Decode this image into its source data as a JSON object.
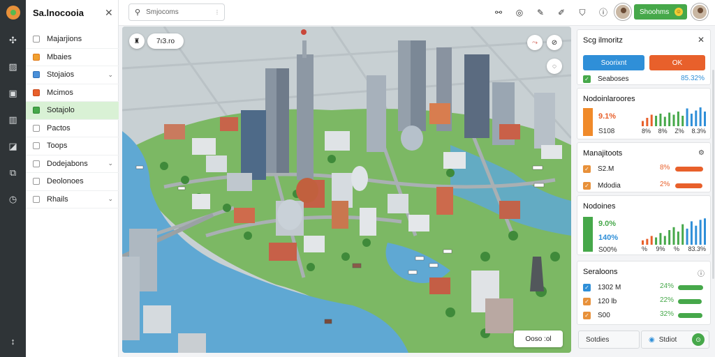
{
  "app": {
    "title": "Sa.lnocooia"
  },
  "search": {
    "placeholder": "Smjocoms",
    "value": ""
  },
  "colors": {
    "accent_green": "#46a84a",
    "accent_blue": "#2f8fd8",
    "accent_orange": "#e8602b",
    "rail": "#2f3437"
  },
  "rail_icons": [
    "compass-icon",
    "map-icon",
    "image-icon",
    "grid-icon",
    "chart-icon",
    "filter-icon",
    "clock-icon",
    "move-icon"
  ],
  "sidebar": {
    "items": [
      {
        "label": "Majarjions",
        "color": "#ffffff",
        "border": "#999999",
        "chevron": false,
        "active": false
      },
      {
        "label": "Mbaies",
        "color": "#f0a030",
        "border": "#e07a1a",
        "chevron": false,
        "active": false
      },
      {
        "label": "Stojaios",
        "color": "#4a90d9",
        "border": "#2e6fb6",
        "chevron": true,
        "active": false
      },
      {
        "label": "Mcimos",
        "color": "#e8602b",
        "border": "#c8471a",
        "chevron": false,
        "active": false
      },
      {
        "label": "Sotajolo",
        "color": "#46a84a",
        "border": "#2f8a33",
        "chevron": false,
        "active": true
      },
      {
        "label": "Pactos",
        "color": "#ffffff",
        "border": "#999999",
        "chevron": false,
        "active": false
      },
      {
        "label": "Toops",
        "color": "#ffffff",
        "border": "#999999",
        "chevron": false,
        "active": false
      },
      {
        "label": "Dodejabons",
        "color": "#ffffff",
        "border": "#999999",
        "chevron": true,
        "active": false
      },
      {
        "label": "Deolonoes",
        "color": "#ffffff",
        "border": "#999999",
        "chevron": false,
        "active": false
      },
      {
        "label": "Rhails",
        "color": "#ffffff",
        "border": "#999999",
        "chevron": true,
        "active": false
      }
    ]
  },
  "toolbar": {
    "icons": [
      "share-icon",
      "target-icon",
      "edit-icon",
      "pen-icon",
      "shield-icon",
      "info-icon"
    ]
  },
  "profile": {
    "currency_label": "Shoohms"
  },
  "map": {
    "top_left_chip": "7ıЗ.ro",
    "bottom_right_chip": "Ooso :ol"
  },
  "panel": {
    "header": "Scg ilmoritz",
    "btn_primary": "Soorixnt",
    "btn_secondary": "OK",
    "check_label": "Seaboses",
    "check_value": "85.32%",
    "card1": {
      "title": "Nodoinlaroores",
      "big": "9.1%",
      "sub": "S108",
      "labels": [
        "8%",
        "8%",
        "Z%",
        "8.3%"
      ],
      "bars": [
        0.25,
        0.4,
        0.55,
        0.5,
        0.6,
        0.45,
        0.65,
        0.55,
        0.7,
        0.5,
        0.85,
        0.6,
        0.75,
        0.9,
        0.7
      ]
    },
    "card2": {
      "title": "Manajitoots",
      "rows": [
        {
          "label": "S2.M",
          "pct": "8%",
          "color": "#e8602b",
          "fill": 0.92
        },
        {
          "label": "Mdodia",
          "pct": "2%",
          "color": "#e8602b",
          "fill": 0.88
        }
      ]
    },
    "card3": {
      "title": "Nodoines",
      "big": "9.0%",
      "big2": "140%",
      "sub": "S00%",
      "labels": [
        "%",
        "9%",
        "%",
        "83.3%"
      ],
      "bars": [
        0.15,
        0.2,
        0.3,
        0.25,
        0.4,
        0.3,
        0.5,
        0.6,
        0.45,
        0.7,
        0.55,
        0.8,
        0.65,
        0.85,
        0.9
      ]
    },
    "card4": {
      "title": "Seraloons",
      "rows": [
        {
          "label": "1302 M",
          "pct": "24%",
          "color": "#46a84a",
          "check": "#2f8fd8",
          "fill": 0.95
        },
        {
          "label": "120 lb",
          "pct": "22%",
          "color": "#46a84a",
          "check": "#e8913a",
          "fill": 0.9
        },
        {
          "label": "S00",
          "pct": "32%",
          "color": "#46a84a",
          "check": "#e8913a",
          "fill": 0.92
        }
      ]
    },
    "bottom_left": "Sotdies",
    "bottom_right": "Stdiot"
  }
}
